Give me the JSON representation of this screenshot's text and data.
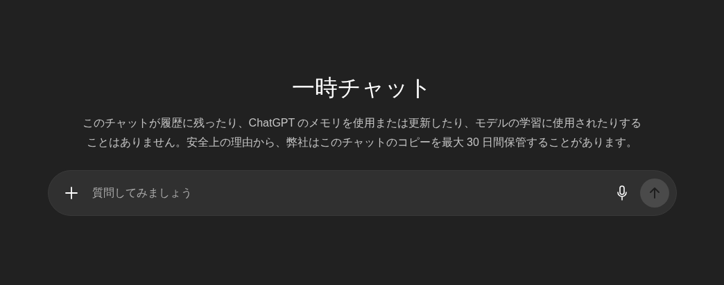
{
  "title": "一時チャット",
  "description_lines": [
    "このチャットが履歴に残ったり、ChatGPT のメモリを使用または更新したり、モデルの学習に使用されたりする",
    "ことはありません。安全上の理由から、弊社はこのチャットのコピーを最大 30 日間保管することがあります。"
  ],
  "composer": {
    "placeholder": "質問してみましょう",
    "send_disabled": true
  }
}
